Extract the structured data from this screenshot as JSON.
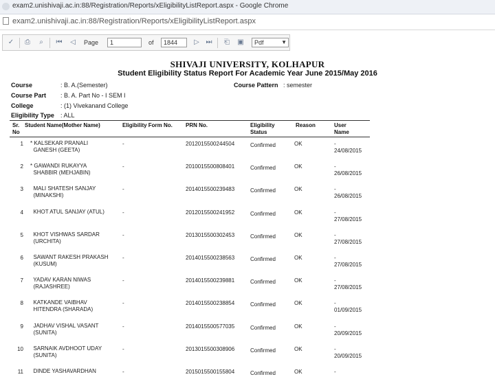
{
  "window": {
    "title": "exam2.unishivaji.ac.in:88/Registration/Reports/xEligibilityListReport.aspx - Google Chrome",
    "url": "exam2.unishivaji.ac.in:88/Registration/Reports/xEligibilityListReport.aspx"
  },
  "toolbar": {
    "page_label": "Page",
    "page_value": "1",
    "of_label": "of",
    "total_pages": "1844",
    "format_value": "Pdf"
  },
  "report": {
    "university": "SHIVAJI UNIVERSITY, KOLHAPUR",
    "title": "Student Eligibility Status Report For Academic Year  June 2015/May 2016",
    "course_label": "Course",
    "course_value": ": B. A.(Semester)",
    "course_part_label": "Course Part",
    "course_part_value": ": B. A. Part No - I SEM I",
    "college_label": "College",
    "college_value": ": (1) Vivekanand College",
    "eligibility_type_label": "Eligibility Type",
    "eligibility_type_value": ": ALL",
    "course_pattern_label": "Course Pattern",
    "course_pattern_value": ": semester",
    "columns": {
      "sr_no": "Sr.\nNo",
      "student_name": "Student Name(Mother Name)",
      "form_no": "Eligibility Form No.",
      "prn": "PRN No.",
      "status": "Eligibility\nStatus",
      "reason": "Reason",
      "user": "User\nName"
    },
    "rows": [
      {
        "sr": "1",
        "name": "* KALSEKAR PRANALI\n  GANESH (GEETA)",
        "form": "-",
        "prn": "2012015500244504",
        "status": "Confirmed",
        "reason": "OK",
        "user": "-\n24/08/2015"
      },
      {
        "sr": "2",
        "name": "* GAWANDI RUKAYYA\n  SHABBIR (MEHJABIN)",
        "form": "-",
        "prn": "2010015500808401",
        "status": "Confirmed",
        "reason": "OK",
        "user": "-\n26/08/2015"
      },
      {
        "sr": "3",
        "name": "  MALI SHATESH SANJAY\n  (MINAKSHI)",
        "form": "-",
        "prn": "2014015500239483",
        "status": "Confirmed",
        "reason": "OK",
        "user": "-\n26/08/2015"
      },
      {
        "sr": "4",
        "name": "  KHOT ATUL SANJAY (ATUL)",
        "form": "-",
        "prn": "2012015500241952",
        "status": "Confirmed",
        "reason": "OK",
        "user": "-\n27/08/2015"
      },
      {
        "sr": "5",
        "name": "  KHOT VISHWAS SARDAR\n  (URCHITA)",
        "form": "-",
        "prn": "2013015500302453",
        "status": "Confirmed",
        "reason": "OK",
        "user": "-\n27/08/2015"
      },
      {
        "sr": "6",
        "name": "  SAWANT RAKESH PRAKASH\n  (KUSUM)",
        "form": "-",
        "prn": "2014015500238563",
        "status": "Confirmed",
        "reason": "OK",
        "user": "-\n27/08/2015"
      },
      {
        "sr": "7",
        "name": "  YADAV KARAN NIWAS\n  (RAJASHREE)",
        "form": "-",
        "prn": "2014015500239881",
        "status": "Confirmed",
        "reason": "OK",
        "user": "-\n27/08/2015"
      },
      {
        "sr": "8",
        "name": "  KATKANDE VAIBHAV\n  HITENDRA (SHARADA)",
        "form": "-",
        "prn": "2014015500238854",
        "status": "Confirmed",
        "reason": "OK",
        "user": "-\n01/09/2015"
      },
      {
        "sr": "9",
        "name": "  JADHAV VISHAL VASANT\n  (SUNITA)",
        "form": "-",
        "prn": "2014015500577035",
        "status": "Confirmed",
        "reason": "OK",
        "user": "-\n20/09/2015"
      },
      {
        "sr": "10",
        "name": "  SARNAIK AVDHOOT UDAY\n  (SUNITA)",
        "form": "-",
        "prn": "2013015500308906",
        "status": "Confirmed",
        "reason": "OK",
        "user": "-\n20/09/2015"
      },
      {
        "sr": "11",
        "name": "  DINDE YASHAVARDHAN",
        "form": "-",
        "prn": "2015015500155804",
        "status": "Confirmed",
        "reason": "OK",
        "user": "-"
      }
    ]
  },
  "icons": {
    "toolbar": [
      "check-icon",
      "print-icon",
      "find-icon",
      "first-page-icon",
      "prev-page-icon",
      "next-page-icon",
      "last-page-icon",
      "export-icon",
      "save-icon"
    ]
  },
  "colors": {
    "toolbar_bg": "#f6f6f6",
    "icon_blue": "#6b7b93",
    "text": "#111111"
  }
}
